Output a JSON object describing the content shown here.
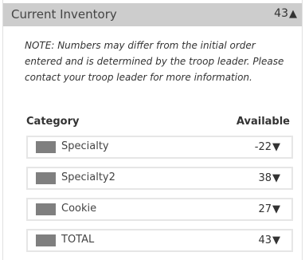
{
  "header": {
    "title": "Current Inventory",
    "total": "43",
    "arrow": "▲"
  },
  "note": "NOTE: Numbers may differ from the initial order entered and is determined by the troop leader. Please contact your troop leader for more information.",
  "table": {
    "category_label": "Category",
    "available_label": "Available",
    "swatch_color": "#7f7f7f",
    "rows": [
      {
        "label": "Specialty",
        "value": "-22",
        "arrow": "▼"
      },
      {
        "label": "Specialty2",
        "value": "38",
        "arrow": "▼"
      },
      {
        "label": "Cookie",
        "value": "27",
        "arrow": "▼"
      },
      {
        "label": "TOTAL",
        "value": "43",
        "arrow": "▼"
      }
    ]
  }
}
